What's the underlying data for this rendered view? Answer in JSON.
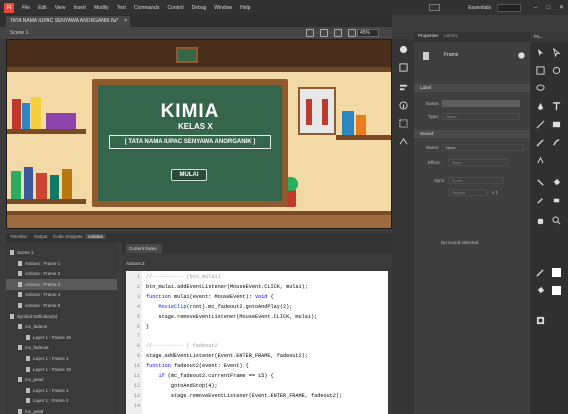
{
  "menubar": {
    "logo": "Fl",
    "items": [
      "File",
      "Edit",
      "View",
      "Insert",
      "Modify",
      "Text",
      "Commands",
      "Control",
      "Debug",
      "Window",
      "Help"
    ],
    "workspace": "Essentials",
    "window_controls": [
      "–",
      "□",
      "✕"
    ]
  },
  "document": {
    "tab_title": "TATA NAMA IUPAC SENYAWA ANORGANIK.fla*",
    "close_glyph": "×",
    "scene": "Scene 1",
    "zoom": "45%"
  },
  "stage": {
    "title": "KIMIA",
    "subtitle": "KELAS X",
    "band_text": "[ TATA NAMA IUPAC SENYAWA ANORGANIK ]",
    "button_text": "MULAI",
    "colors": {
      "wall": "#f2d9a6",
      "board": "#35654a",
      "frame": "#8f5a2e"
    }
  },
  "properties": {
    "tabs": [
      "Properties",
      "Library"
    ],
    "object_type": "Frame",
    "label_section": "Label",
    "label_name": "Name:",
    "label_type": "Type:",
    "label_type_value": "Name",
    "sound_section": "Sound",
    "sound_name": "Name:",
    "sound_name_value": "None",
    "sound_effect": "Effect:",
    "sound_effect_value": "None",
    "sound_sync": "Sync:",
    "sound_sync_value": "Event",
    "sound_repeat": "Repeat",
    "sound_repeat_count": "x 1",
    "no_sound": "No sound selected"
  },
  "tools_header": "Pa...",
  "bottom_tabs": [
    "Timeline",
    "Output",
    "Code Snippets",
    "Actions"
  ],
  "tree": [
    {
      "label": "Scene 1",
      "indent": 0,
      "icon": "scene-icon",
      "selected": false
    },
    {
      "label": "Actions : Frame 1",
      "indent": 1,
      "icon": "actions-icon",
      "selected": false
    },
    {
      "label": "Actions : Frame 2",
      "indent": 1,
      "icon": "actions-icon",
      "selected": false
    },
    {
      "label": "Actions : Frame 3",
      "indent": 1,
      "icon": "actions-icon",
      "selected": true
    },
    {
      "label": "Actions : Frame 4",
      "indent": 1,
      "icon": "actions-icon",
      "selected": false
    },
    {
      "label": "Actions : Frame 5",
      "indent": 1,
      "icon": "actions-icon",
      "selected": false
    },
    {
      "label": "Symbol Definition(s)",
      "indent": 0,
      "icon": "symbol-icon",
      "selected": false
    },
    {
      "label": "mc_fadeon",
      "indent": 1,
      "icon": "movieclip-icon",
      "selected": false
    },
    {
      "label": "Layer 1 : Frame 16",
      "indent": 2,
      "icon": "layer-icon",
      "selected": false
    },
    {
      "label": "mc_fadeout",
      "indent": 1,
      "icon": "movieclip-icon",
      "selected": false
    },
    {
      "label": "Layer 1 : Frame 1",
      "indent": 2,
      "icon": "layer-icon",
      "selected": false
    },
    {
      "label": "Layer 1 : Frame 15",
      "indent": 2,
      "icon": "layer-icon",
      "selected": false
    },
    {
      "label": "mc_pearl",
      "indent": 1,
      "icon": "movieclip-icon",
      "selected": false
    },
    {
      "label": "Layer 1 : Frame 1",
      "indent": 2,
      "icon": "layer-icon",
      "selected": false
    },
    {
      "label": "Layer 1 : Frame 2",
      "indent": 2,
      "icon": "layer-icon",
      "selected": false
    },
    {
      "label": "mc_pelaf",
      "indent": 1,
      "icon": "movieclip-icon",
      "selected": false
    }
  ],
  "code": {
    "tab": "Current frame",
    "path": "Actions:3",
    "lines": [
      {
        "n": "1",
        "parts": [
          [
            "cm",
            "//---------- (btn_mulai)"
          ]
        ]
      },
      {
        "n": "2",
        "parts": [
          [
            "tx",
            "btn_mulai.addEventListener(MouseEvent.CLICK, mulai);"
          ]
        ]
      },
      {
        "n": "3",
        "parts": [
          [
            "kw",
            "function"
          ],
          [
            "tx",
            " mulai(event: MouseEvent): "
          ],
          [
            "kw",
            "void"
          ],
          [
            "tx",
            " {"
          ]
        ]
      },
      {
        "n": "4",
        "parts": [
          [
            "tx",
            "    "
          ],
          [
            "fn",
            "MovieClip"
          ],
          [
            "tx",
            "(root).mc_fadeout2.gotoAndPlay(2);"
          ]
        ]
      },
      {
        "n": "5",
        "parts": [
          [
            "tx",
            "    stage.removeEventListener(MouseEvent.CLICK, mulai);"
          ]
        ]
      },
      {
        "n": "6",
        "parts": [
          [
            "tx",
            "}"
          ]
        ]
      },
      {
        "n": "7",
        "parts": [
          [
            "tx",
            ""
          ]
        ]
      },
      {
        "n": "8",
        "parts": [
          [
            "cm",
            "//---------- ( fadeout2"
          ]
        ]
      },
      {
        "n": "9",
        "parts": [
          [
            "tx",
            "stage.addEventListener(Event.ENTER_FRAME, fadeout2);"
          ]
        ]
      },
      {
        "n": "10",
        "parts": [
          [
            "kw",
            "function"
          ],
          [
            "tx",
            " fadeout2(event: Event) {"
          ]
        ]
      },
      {
        "n": "11",
        "parts": [
          [
            "tx",
            "    "
          ],
          [
            "kw",
            "if"
          ],
          [
            "tx",
            " (mc_fadeout2.currentFrame == 15) {"
          ]
        ]
      },
      {
        "n": "12",
        "parts": [
          [
            "tx",
            "        gotoAndStop(4);"
          ]
        ]
      },
      {
        "n": "13",
        "parts": [
          [
            "tx",
            "        stage.removeEventListener(Event.ENTER_FRAME, fadeout2);"
          ]
        ]
      },
      {
        "n": "14",
        "parts": [
          [
            "tx",
            ""
          ]
        ]
      }
    ]
  }
}
